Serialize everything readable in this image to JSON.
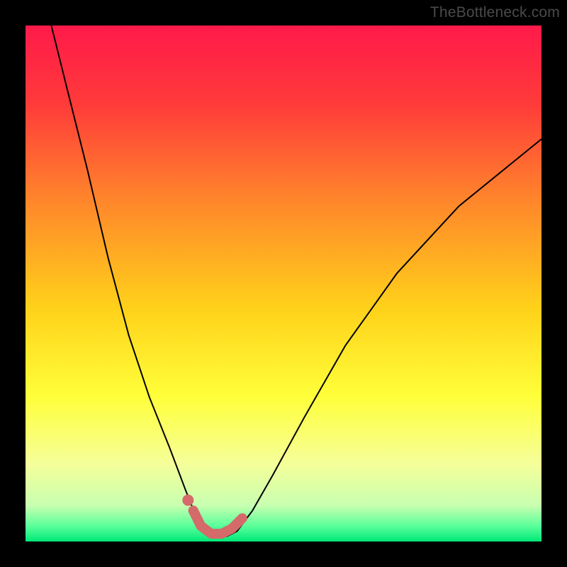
{
  "watermark": "TheBottleneck.com",
  "chart_data": {
    "type": "line",
    "title": "",
    "xlabel": "",
    "ylabel": "",
    "xlim": [
      0,
      100
    ],
    "ylim": [
      0,
      100
    ],
    "background_gradient": {
      "stops": [
        {
          "offset": 0.0,
          "color": "#ff1a4a"
        },
        {
          "offset": 0.15,
          "color": "#ff3a3a"
        },
        {
          "offset": 0.35,
          "color": "#ff8a2a"
        },
        {
          "offset": 0.55,
          "color": "#ffd21a"
        },
        {
          "offset": 0.72,
          "color": "#ffff3a"
        },
        {
          "offset": 0.85,
          "color": "#f5ff9a"
        },
        {
          "offset": 0.93,
          "color": "#c8ffb0"
        },
        {
          "offset": 0.97,
          "color": "#5aff9a"
        },
        {
          "offset": 1.0,
          "color": "#00e878"
        }
      ]
    },
    "series": [
      {
        "name": "curve",
        "color": "#000000",
        "width": 2,
        "points": [
          {
            "x": 5,
            "y": 100
          },
          {
            "x": 8,
            "y": 88
          },
          {
            "x": 12,
            "y": 72
          },
          {
            "x": 16,
            "y": 55
          },
          {
            "x": 20,
            "y": 40
          },
          {
            "x": 24,
            "y": 28
          },
          {
            "x": 28,
            "y": 18
          },
          {
            "x": 31,
            "y": 10
          },
          {
            "x": 33,
            "y": 5
          },
          {
            "x": 35,
            "y": 2
          },
          {
            "x": 37,
            "y": 1
          },
          {
            "x": 39,
            "y": 1
          },
          {
            "x": 41,
            "y": 2
          },
          {
            "x": 44,
            "y": 6
          },
          {
            "x": 48,
            "y": 13
          },
          {
            "x": 54,
            "y": 24
          },
          {
            "x": 62,
            "y": 38
          },
          {
            "x": 72,
            "y": 52
          },
          {
            "x": 84,
            "y": 65
          },
          {
            "x": 100,
            "y": 78
          }
        ]
      },
      {
        "name": "highlight",
        "color": "#d46a6a",
        "width": 14,
        "points": [
          {
            "x": 32.5,
            "y": 6
          },
          {
            "x": 34,
            "y": 3
          },
          {
            "x": 36,
            "y": 1.5
          },
          {
            "x": 38,
            "y": 1.5
          },
          {
            "x": 40,
            "y": 2.5
          },
          {
            "x": 42,
            "y": 4.5
          }
        ]
      }
    ],
    "markers": [
      {
        "name": "dot",
        "x": 31.5,
        "y": 8,
        "r": 8,
        "color": "#d46a6a"
      }
    ]
  }
}
